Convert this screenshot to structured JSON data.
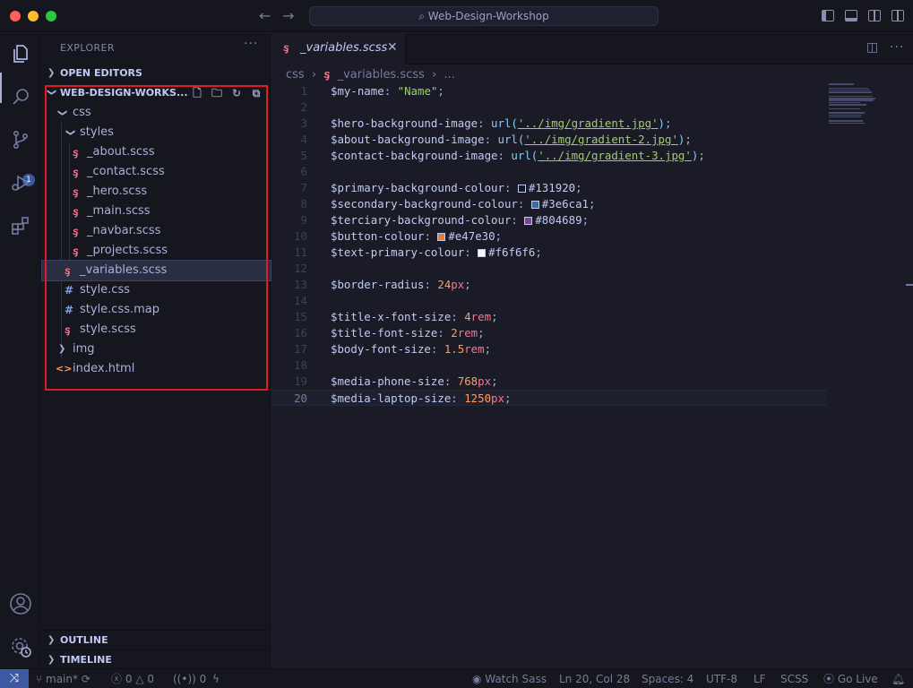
{
  "window": {
    "title": "Web-Design-Workshop"
  },
  "sidebar": {
    "title": "EXPLORER",
    "sections": {
      "open_editors": "OPEN EDITORS",
      "workspace": "WEB-DESIGN-WORKS...",
      "outline": "OUTLINE",
      "timeline": "TIMELINE"
    },
    "tree": [
      {
        "label": "css",
        "type": "folder-open"
      },
      {
        "label": "styles",
        "type": "folder-open"
      },
      {
        "label": "_about.scss",
        "type": "scss"
      },
      {
        "label": "_contact.scss",
        "type": "scss"
      },
      {
        "label": "_hero.scss",
        "type": "scss"
      },
      {
        "label": "_main.scss",
        "type": "scss"
      },
      {
        "label": "_navbar.scss",
        "type": "scss"
      },
      {
        "label": "_projects.scss",
        "type": "scss"
      },
      {
        "label": "_variables.scss",
        "type": "scss",
        "selected": true
      },
      {
        "label": "style.css",
        "type": "css"
      },
      {
        "label": "style.css.map",
        "type": "css"
      },
      {
        "label": "style.scss",
        "type": "scss"
      },
      {
        "label": "img",
        "type": "folder-closed"
      },
      {
        "label": "index.html",
        "type": "html"
      }
    ]
  },
  "activity": {
    "scm_badge": "1"
  },
  "editor": {
    "tab": {
      "label": "_variables.scss",
      "icon": "sass-icon"
    },
    "breadcrumb": {
      "folder": "css",
      "file": "_variables.scss",
      "more": "..."
    },
    "current_line": 20,
    "lines": [
      {
        "n": "1",
        "var": "$my-name",
        "string": "\"Name\""
      },
      {
        "n": "2"
      },
      {
        "n": "3",
        "var": "$hero-background-image",
        "url": "'../img/gradient.jpg'"
      },
      {
        "n": "4",
        "var": "$about-background-image",
        "url": "'../img/gradient-2.jpg'"
      },
      {
        "n": "5",
        "var": "$contact-background-image",
        "url": "'../img/gradient-3.jpg'"
      },
      {
        "n": "6"
      },
      {
        "n": "7",
        "var": "$primary-background-colour",
        "color": "#131920"
      },
      {
        "n": "8",
        "var": "$secondary-background-colour",
        "color": "#3e6ca1"
      },
      {
        "n": "9",
        "var": "$terciary-background-colour",
        "color": "#804689"
      },
      {
        "n": "10",
        "var": "$button-colour",
        "color": "#e47e30"
      },
      {
        "n": "11",
        "var": "$text-primary-colour",
        "color": "#f6f6f6"
      },
      {
        "n": "12"
      },
      {
        "n": "13",
        "var": "$border-radius",
        "num": "24",
        "unit": "px"
      },
      {
        "n": "14"
      },
      {
        "n": "15",
        "var": "$title-x-font-size",
        "num": "4",
        "unit": "rem"
      },
      {
        "n": "16",
        "var": "$title-font-size",
        "num": "2",
        "unit": "rem"
      },
      {
        "n": "17",
        "var": "$body-font-size",
        "num": "1.5",
        "unit": "rem"
      },
      {
        "n": "18"
      },
      {
        "n": "19",
        "var": "$media-phone-size",
        "num": "768",
        "unit": "px"
      },
      {
        "n": "20",
        "var": "$media-laptop-size",
        "num": "1250",
        "unit": "px"
      }
    ]
  },
  "statusbar": {
    "branch": "main*",
    "errors": "0",
    "warnings": "0",
    "ports": "0",
    "watch_sass": "Watch Sass",
    "cursor": "Ln 20, Col 28",
    "spaces": "Spaces: 4",
    "encoding": "UTF-8",
    "eol": "LF",
    "language": "SCSS",
    "go_live": "Go Live"
  },
  "colors": {
    "accent": "#3d59a1",
    "highlight_frame": "#e01b24"
  }
}
